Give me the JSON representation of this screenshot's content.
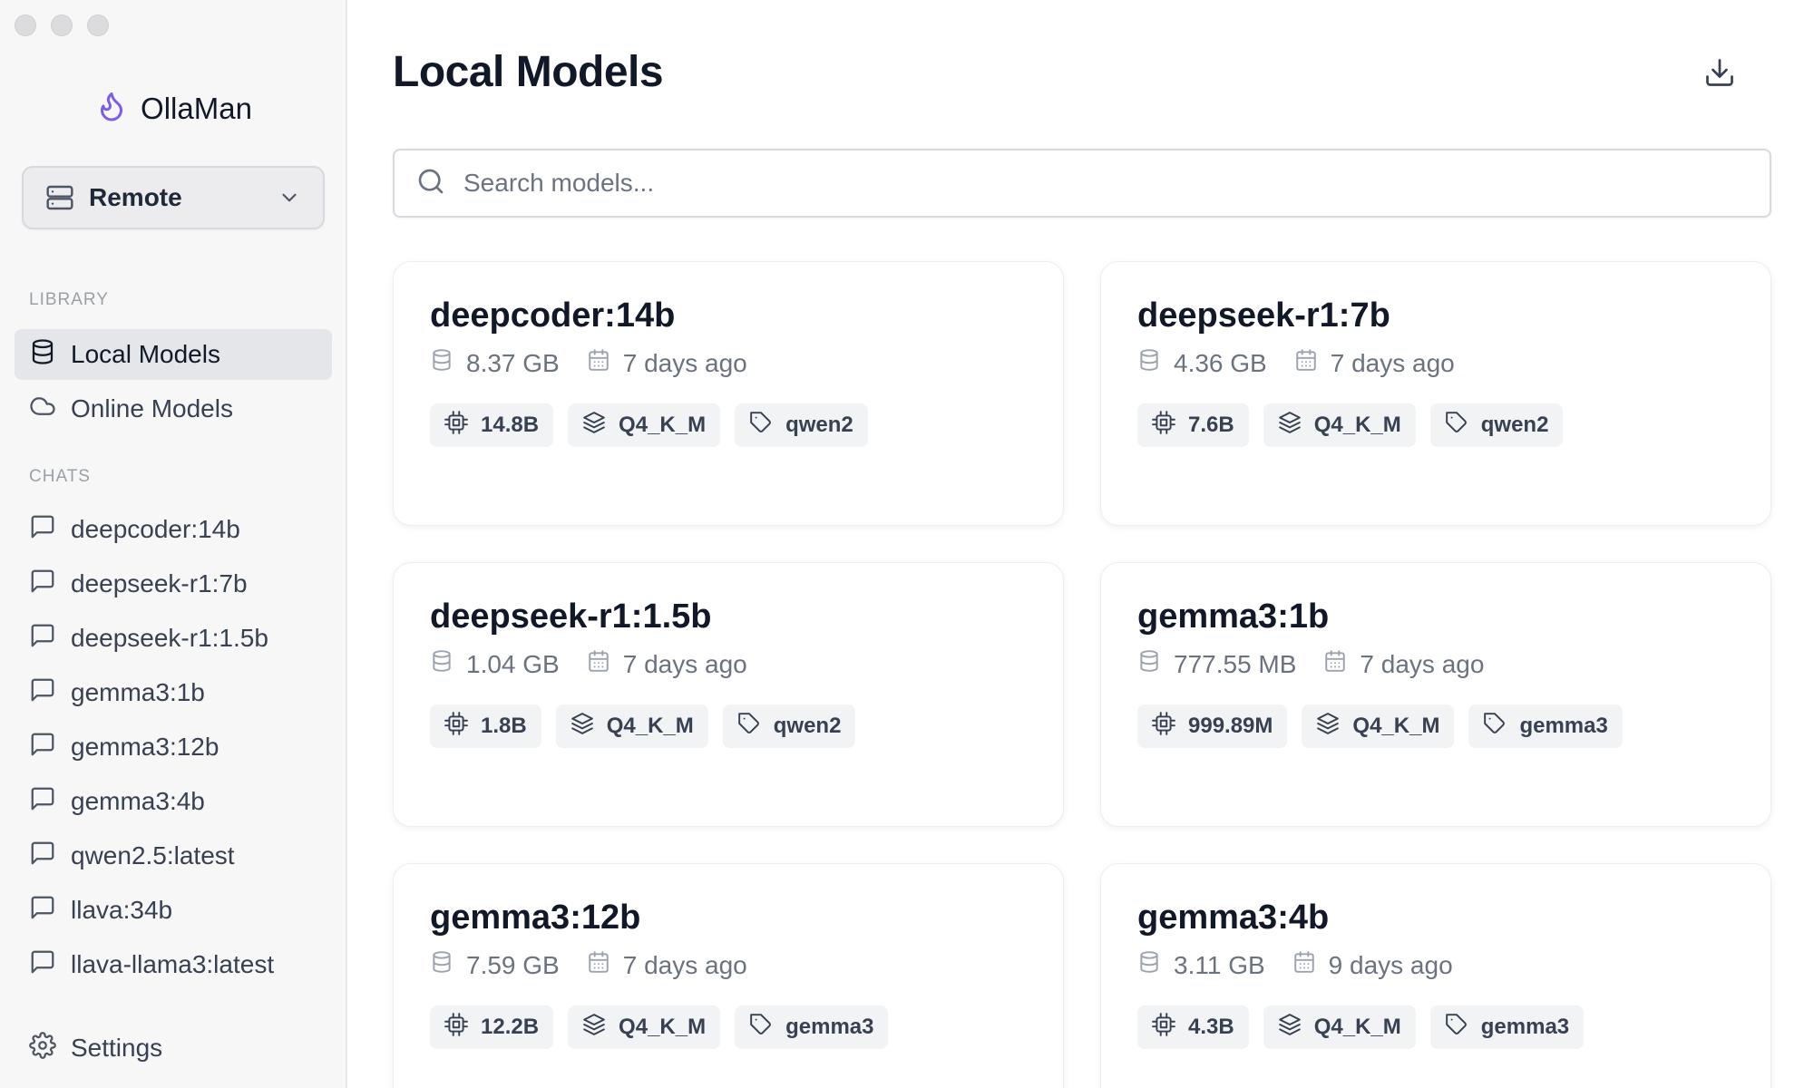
{
  "app": {
    "name": "OllaMan"
  },
  "server": {
    "label": "Remote"
  },
  "sidebar": {
    "library_label": "LIBRARY",
    "library_items": [
      {
        "label": "Local Models",
        "icon": "database-icon",
        "active": true
      },
      {
        "label": "Online Models",
        "icon": "cloud-icon",
        "active": false
      }
    ],
    "chats_label": "CHATS",
    "chats": [
      "deepcoder:14b",
      "deepseek-r1:7b",
      "deepseek-r1:1.5b",
      "gemma3:1b",
      "gemma3:12b",
      "gemma3:4b",
      "qwen2.5:latest",
      "llava:34b",
      "llava-llama3:latest"
    ],
    "settings_label": "Settings"
  },
  "main": {
    "title": "Local Models",
    "search_placeholder": "Search models...",
    "models": [
      {
        "name": "deepcoder:14b",
        "size": "8.37 GB",
        "modified": "7 days ago",
        "params": "14.8B",
        "quant": "Q4_K_M",
        "family": "qwen2"
      },
      {
        "name": "deepseek-r1:7b",
        "size": "4.36 GB",
        "modified": "7 days ago",
        "params": "7.6B",
        "quant": "Q4_K_M",
        "family": "qwen2"
      },
      {
        "name": "deepseek-r1:1.5b",
        "size": "1.04 GB",
        "modified": "7 days ago",
        "params": "1.8B",
        "quant": "Q4_K_M",
        "family": "qwen2"
      },
      {
        "name": "gemma3:1b",
        "size": "777.55 MB",
        "modified": "7 days ago",
        "params": "999.89M",
        "quant": "Q4_K_M",
        "family": "gemma3"
      },
      {
        "name": "gemma3:12b",
        "size": "7.59 GB",
        "modified": "7 days ago",
        "params": "12.2B",
        "quant": "Q4_K_M",
        "family": "gemma3"
      },
      {
        "name": "gemma3:4b",
        "size": "3.11 GB",
        "modified": "9 days ago",
        "params": "4.3B",
        "quant": "Q4_K_M",
        "family": "gemma3"
      }
    ]
  },
  "colors": {
    "accent": "#7c5cf0",
    "text": "#111827",
    "muted": "#6b7280",
    "sidebar_bg": "#f7f7f8"
  }
}
